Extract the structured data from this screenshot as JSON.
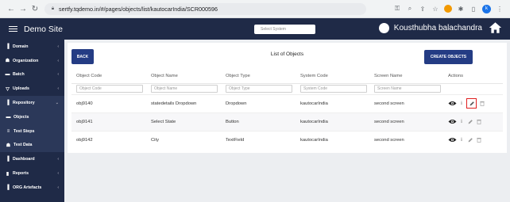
{
  "browser": {
    "url": "sertfy.tqdemo.in/#/pages/objects/list/kautocarIndia/SCR000596",
    "profile_initial": "k"
  },
  "header": {
    "title": "Demo Site",
    "system_placeholder": "Select System",
    "user_name": "Kousthubha balachandra"
  },
  "sidebar": {
    "items": [
      {
        "label": "Domain",
        "icon": "bar-chart-icon"
      },
      {
        "label": "Organization",
        "icon": "sitemap-icon"
      },
      {
        "label": "Batch",
        "icon": "folder-icon"
      },
      {
        "label": "Uploads",
        "icon": "filter-icon"
      },
      {
        "label": "Repository",
        "icon": "bar-chart-icon"
      },
      {
        "label": "Objects",
        "icon": "box-icon"
      },
      {
        "label": "Test Steps",
        "icon": "list-icon"
      },
      {
        "label": "Test Data",
        "icon": "sitemap-icon"
      },
      {
        "label": "Dashboard",
        "icon": "bar-chart-icon"
      },
      {
        "label": "Reports",
        "icon": "document-icon"
      },
      {
        "label": "ORG Artefacts",
        "icon": "bar-chart-icon"
      }
    ]
  },
  "page": {
    "back_label": "BACK",
    "title": "List of Objects",
    "create_label": "CREATE OBJECTS"
  },
  "table": {
    "columns": [
      "Object Code",
      "Object Name",
      "Object Type",
      "System Code",
      "Screen Name",
      "Actions"
    ],
    "filters": [
      "Object Code",
      "Object Name",
      "Object Type",
      "System Code",
      "Screen Name"
    ],
    "rows": [
      [
        "obj9140",
        "statedetails Dropdown",
        "Dropdown",
        "kautocarIndia",
        "second screen"
      ],
      [
        "obj9141",
        "Select State",
        "Button",
        "kautocarIndia",
        "second screen"
      ],
      [
        "obj9142",
        "City",
        "TextField",
        "kautocarIndia",
        "second screen"
      ]
    ]
  },
  "colors": {
    "header_bg": "#1f2a47",
    "button_bg": "#243c84",
    "highlight_border": "#e02020"
  }
}
